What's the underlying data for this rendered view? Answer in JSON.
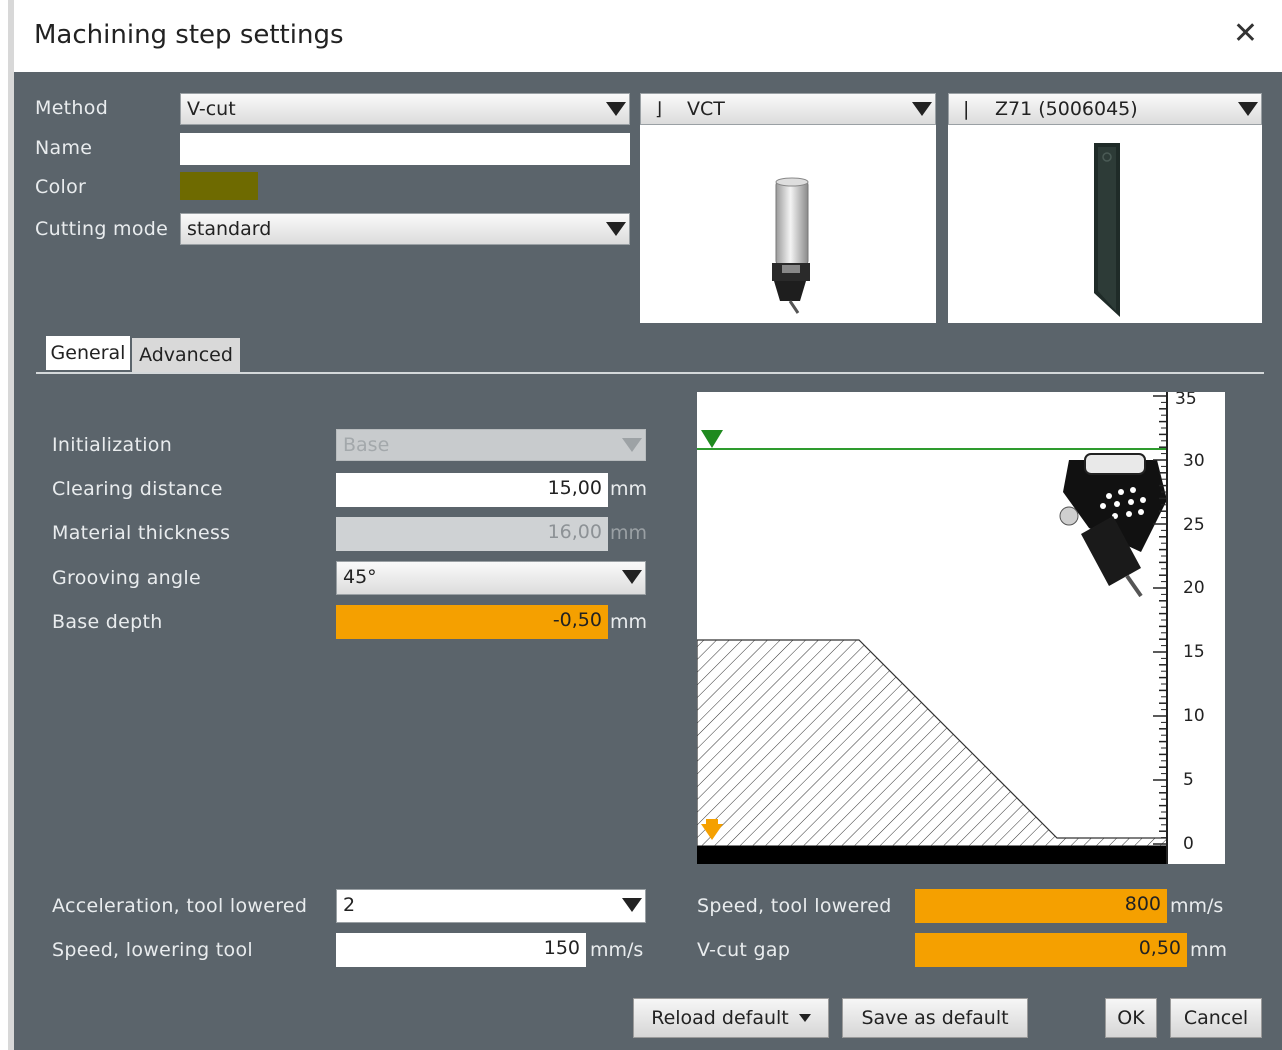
{
  "dialog": {
    "title": "Machining step settings"
  },
  "form": {
    "method_label": "Method",
    "method_value": "V-cut",
    "name_label": "Name",
    "name_value": "",
    "color_label": "Color",
    "color_value": "#6e6a00",
    "cutting_mode_label": "Cutting mode",
    "cutting_mode_value": "standard"
  },
  "tool": {
    "value": "VCT"
  },
  "blade": {
    "value": "Z71 (5006045)"
  },
  "tabs": [
    {
      "label": "General"
    },
    {
      "label": "Advanced"
    }
  ],
  "general": {
    "initialization_label": "Initialization",
    "initialization_value": "Base",
    "clearing_distance_label": "Clearing distance",
    "clearing_distance_value": "15,00",
    "clearing_distance_unit": "mm",
    "material_thickness_label": "Material thickness",
    "material_thickness_value": "16,00",
    "material_thickness_unit": "mm",
    "grooving_angle_label": "Grooving angle",
    "grooving_angle_value": "45°",
    "base_depth_label": "Base depth",
    "base_depth_value": "-0,50",
    "base_depth_unit": "mm"
  },
  "preview": {
    "scale_labels": [
      "35",
      "30",
      "25",
      "20",
      "15",
      "10",
      "5",
      "0"
    ]
  },
  "motion": {
    "acceleration_label": "Acceleration, tool lowered",
    "acceleration_value": "2",
    "speed_lowering_label": "Speed, lowering tool",
    "speed_lowering_value": "150",
    "speed_lowering_unit": "mm/s",
    "speed_lowered_label": "Speed, tool lowered",
    "speed_lowered_value": "800",
    "speed_lowered_unit": "mm/s",
    "vcut_gap_label": "V-cut gap",
    "vcut_gap_value": "0,50",
    "vcut_gap_unit": "mm"
  },
  "buttons": {
    "reload_default": "Reload default",
    "save_default": "Save as default",
    "ok": "OK",
    "cancel": "Cancel"
  },
  "colors": {
    "panel": "#5b646b",
    "highlight": "#f5a000",
    "disabled": "#cfd2d4",
    "surface_line": "#2e9b2e"
  }
}
